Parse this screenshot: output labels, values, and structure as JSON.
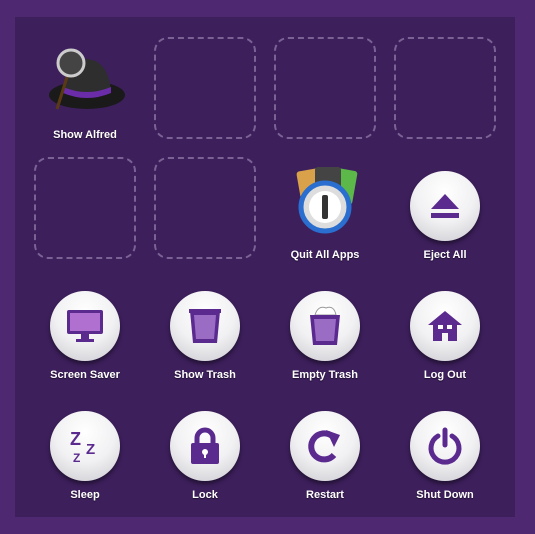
{
  "colors": {
    "background": "#4e2870",
    "panel": "#3d1f5c",
    "icon": "#5b2a8f"
  },
  "items": [
    {
      "label": "Show Alfred",
      "icon": "alfred-hat-icon"
    },
    {
      "label": "Quit All Apps",
      "icon": "apps-1password-icon"
    },
    {
      "label": "Eject All",
      "icon": "eject-icon"
    },
    {
      "label": "Screen Saver",
      "icon": "monitor-icon"
    },
    {
      "label": "Show Trash",
      "icon": "trash-icon"
    },
    {
      "label": "Empty Trash",
      "icon": "full-trash-icon"
    },
    {
      "label": "Log Out",
      "icon": "house-icon"
    },
    {
      "label": "Sleep",
      "icon": "zzz-icon"
    },
    {
      "label": "Lock",
      "icon": "lock-icon"
    },
    {
      "label": "Restart",
      "icon": "restart-icon"
    },
    {
      "label": "Shut Down",
      "icon": "power-icon"
    }
  ]
}
